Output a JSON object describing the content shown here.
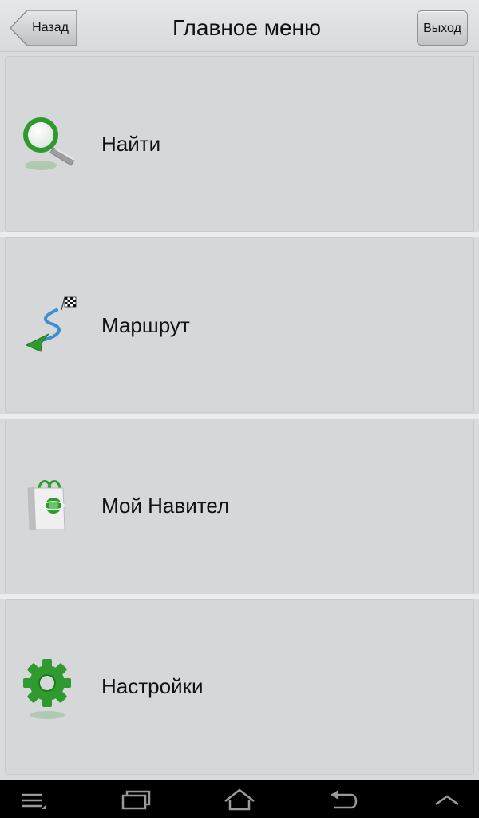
{
  "header": {
    "back_label": "Назад",
    "title": "Главное меню",
    "exit_label": "Выход"
  },
  "menu": {
    "items": [
      {
        "label": "Найти",
        "icon": "magnifier-icon"
      },
      {
        "label": "Маршрут",
        "icon": "route-icon"
      },
      {
        "label": "Мой Навител",
        "icon": "shopping-bag-icon"
      },
      {
        "label": "Настройки",
        "icon": "gear-icon"
      }
    ]
  },
  "navbar": {
    "buttons": [
      "menu-icon",
      "recent-apps-icon",
      "home-icon",
      "back-icon",
      "up-icon"
    ]
  },
  "colors": {
    "accent_green": "#3aa53a",
    "route_blue": "#3a8fd6"
  }
}
